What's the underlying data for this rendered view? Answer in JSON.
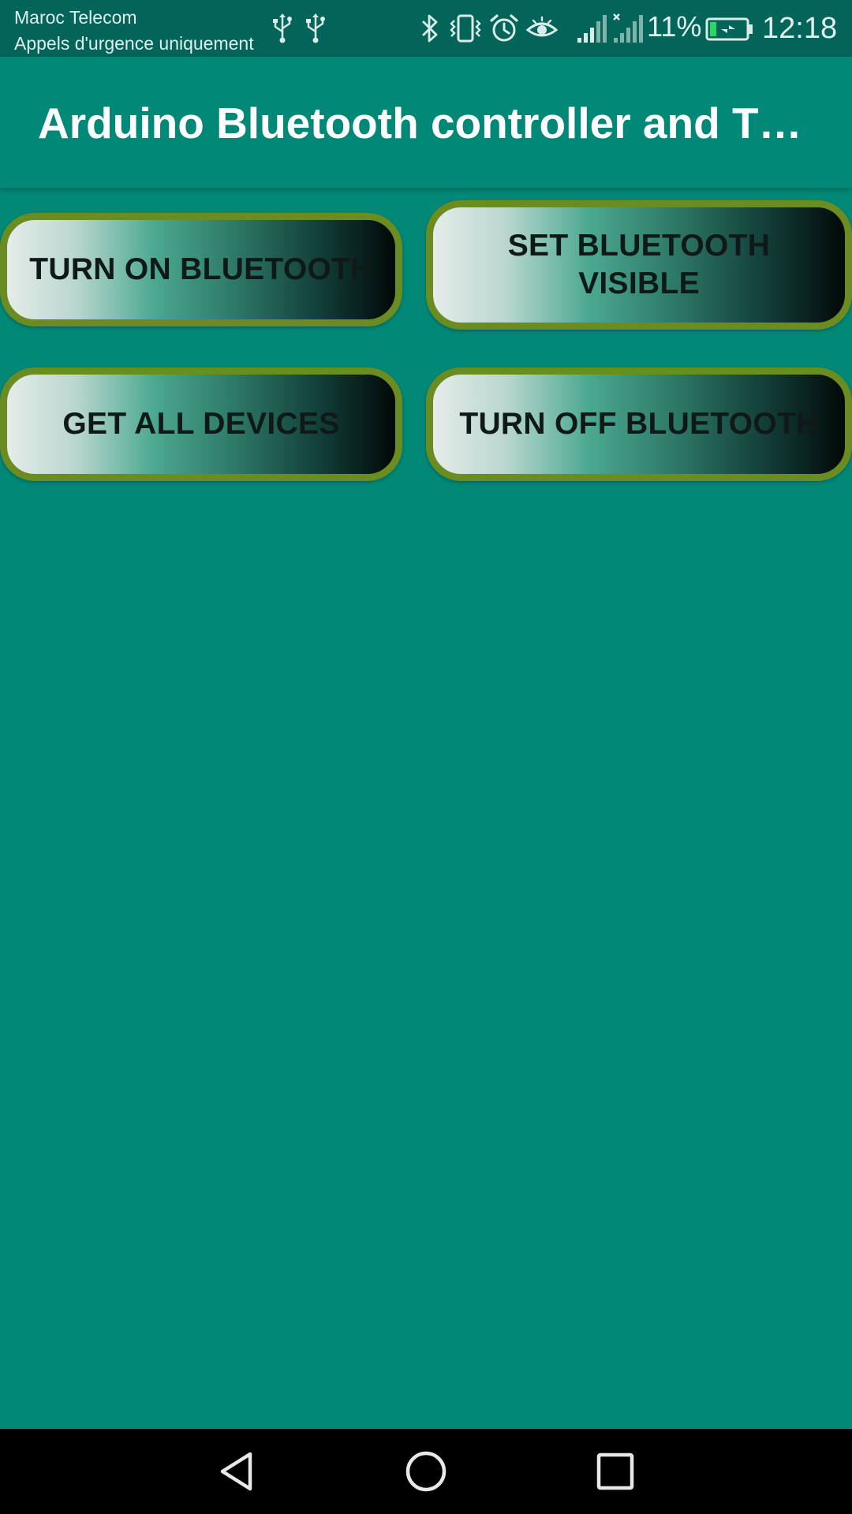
{
  "status_bar": {
    "carrier_line1": "Maroc Telecom",
    "carrier_line2": "Appels d'urgence uniquement",
    "battery_percent": "11%",
    "time": "12:18",
    "icons": [
      "usb-icon",
      "usb-icon",
      "bluetooth-icon",
      "vibrate-icon",
      "alarm-icon",
      "eye-comfort-icon",
      "signal-icon",
      "no-signal-icon",
      "battery-charging-icon"
    ],
    "icon_color": "#d9ece9"
  },
  "app_bar": {
    "title": "Arduino Bluetooth controller and T…"
  },
  "buttons": {
    "turn_on": "TURN ON BLUETOOTH",
    "set_visible": "SET BLUETOOTH VISIBLE",
    "get_devices": "GET ALL DEVICES",
    "turn_off": "TURN OFF BLUETOOTH"
  },
  "nav_bar": {
    "icons": [
      "back-icon",
      "home-icon",
      "recents-icon"
    ]
  },
  "colors": {
    "background": "#028877",
    "status_bar": "#036459",
    "button_border": "#6b8c20",
    "nav_bar": "#000000"
  }
}
